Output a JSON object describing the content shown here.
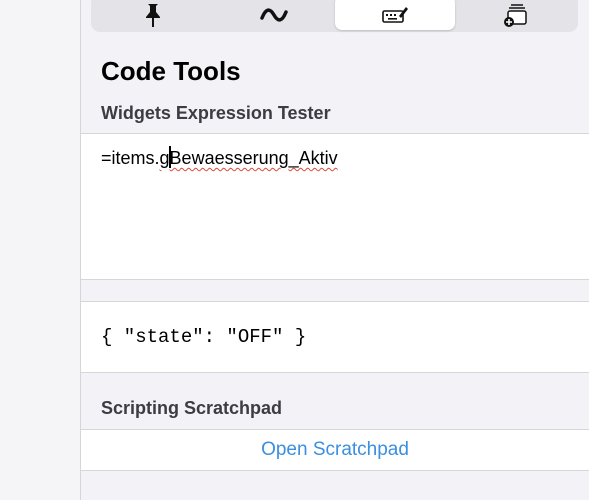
{
  "tabs": [
    {
      "icon": "pin-icon",
      "active": false
    },
    {
      "icon": "wave-icon",
      "active": false
    },
    {
      "icon": "keyboard-edit-icon",
      "active": true
    },
    {
      "icon": "stack-add-icon",
      "active": false
    }
  ],
  "page": {
    "title": "Code Tools"
  },
  "expression_tester": {
    "header": "Widgets Expression Tester",
    "prefix": "=items.",
    "misspelled_a": "g",
    "misspelled_b": "Bewaesserung_Aktiv",
    "result": "{ \"state\": \"OFF\" }"
  },
  "scratchpad": {
    "header": "Scripting Scratchpad",
    "open_label": "Open Scratchpad"
  },
  "colors": {
    "accent": "#3a8fe0",
    "background": "#f2f2f7",
    "spell_underline": "#e0453a"
  }
}
